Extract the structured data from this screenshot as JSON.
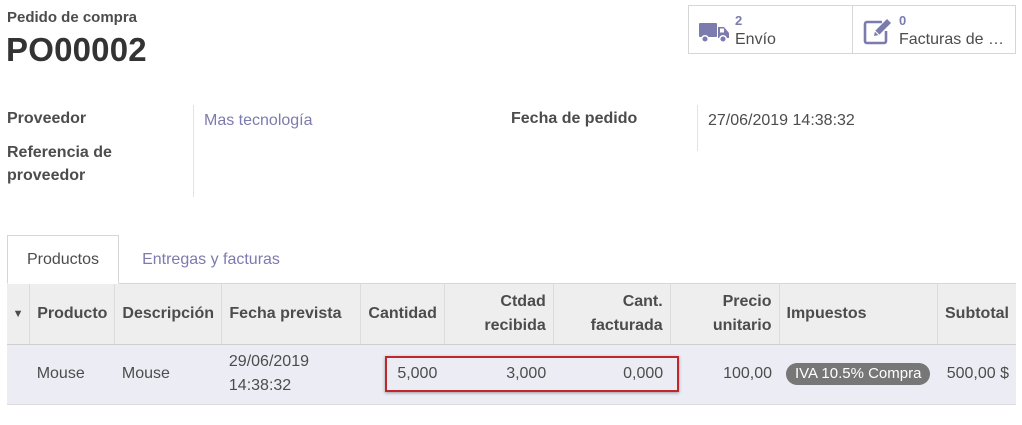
{
  "header": {
    "doc_type": "Pedido de compra",
    "doc_name": "PO00002"
  },
  "smart_buttons": {
    "shipping": {
      "count": "2",
      "label": "Envío",
      "icon": "truck-icon"
    },
    "bills": {
      "count": "0",
      "label": "Facturas de proveedor",
      "icon": "pencil-square-icon"
    }
  },
  "fields": {
    "vendor_label": "Proveedor",
    "vendor_value": "Mas tecnología",
    "vendor_ref_label": "Referencia de proveedor",
    "order_date_label": "Fecha de pedido",
    "order_date_value": "27/06/2019 14:38:32"
  },
  "tabs": [
    {
      "label": "Productos",
      "active": true
    },
    {
      "label": "Entregas y facturas",
      "active": false
    }
  ],
  "table": {
    "columns": {
      "product": "Producto",
      "description": "Descripción",
      "date_planned": "Fecha prevista",
      "qty": "Cantidad",
      "qty_received_1": "Ctdad",
      "qty_received_2": "recibida",
      "qty_invoiced_1": "Cant.",
      "qty_invoiced_2": "facturada",
      "price_1": "Precio",
      "price_2": "unitario",
      "taxes": "Impuestos",
      "subtotal": "Subtotal"
    },
    "rows": [
      {
        "product": "Mouse",
        "description": "Mouse",
        "date_planned_1": "29/06/2019",
        "date_planned_2": "14:38:32",
        "qty": "5,000",
        "qty_received": "3,000",
        "qty_invoiced": "0,000",
        "price_unit": "100,00",
        "taxes": "IVA 10.5% Compra",
        "subtotal": "500,00 $"
      }
    ]
  },
  "colors": {
    "accent": "#7c7bad",
    "highlight": "#c0262b",
    "row_bg": "#ececf5",
    "header_bg": "#eeeeee"
  }
}
